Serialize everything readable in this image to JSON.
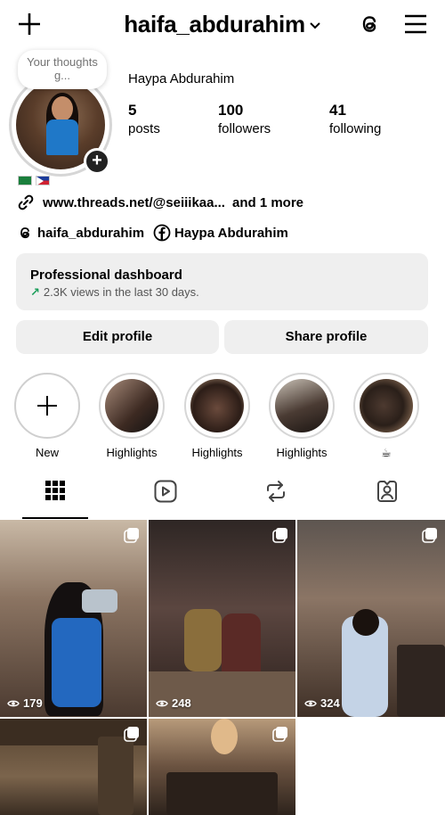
{
  "header": {
    "username": "haifa_abdurahim"
  },
  "profile": {
    "note": "Your thoughts g...",
    "full_name": "Haypa Abdurahim",
    "stats": {
      "posts_value": "5",
      "posts_label": "posts",
      "followers_value": "100",
      "followers_label": "followers",
      "following_value": "41",
      "following_label": "following"
    },
    "link": "www.threads.net/@seiiikaa...",
    "link_more": "and 1 more",
    "threads_handle": "haifa_abdurahim",
    "facebook_name": "Haypa Abdurahim"
  },
  "dashboard": {
    "title": "Professional dashboard",
    "subtitle": "2.3K views in the last 30 days."
  },
  "buttons": {
    "edit": "Edit profile",
    "share": "Share profile"
  },
  "highlights": [
    {
      "label": "New"
    },
    {
      "label": "Highlights"
    },
    {
      "label": "Highlights"
    },
    {
      "label": "Highlights"
    },
    {
      "label": "☕"
    }
  ],
  "tabs": [
    "grid-icon",
    "reels-icon",
    "reposts-icon",
    "tagged-icon"
  ],
  "posts": [
    {
      "views": "179"
    },
    {
      "views": "248"
    },
    {
      "views": "324"
    },
    {
      "views": ""
    },
    {
      "views": ""
    }
  ]
}
